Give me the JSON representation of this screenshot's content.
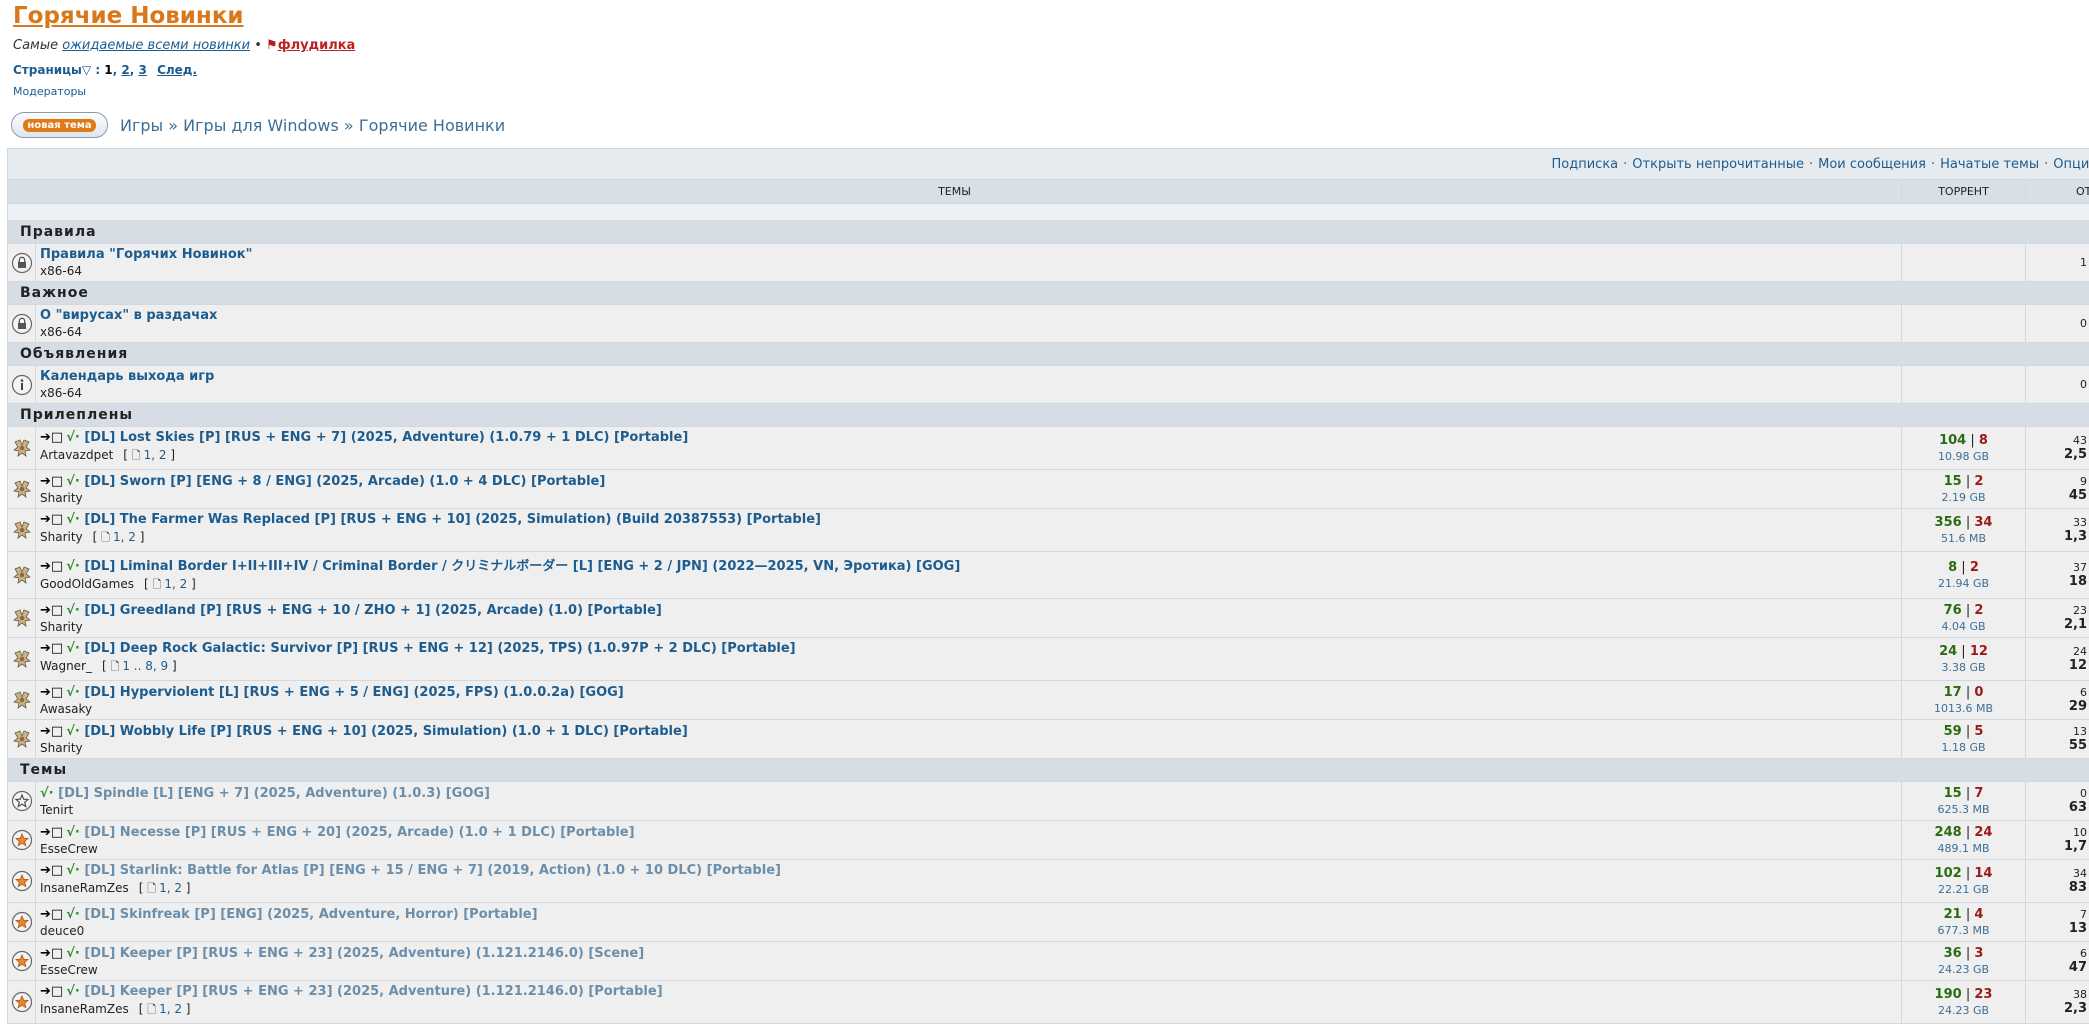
{
  "header": {
    "title": "Горячие Новинки",
    "subtitle_prefix": "Самые",
    "subtitle_link": "ожидаемые всеми новинки",
    "subtitle_sep": "•",
    "flood_link": "флудилка",
    "pager_label": "Страницы",
    "pager_current": "1",
    "pager_pages": [
      "2",
      "3"
    ],
    "pager_next": "След.",
    "moderators": "Модераторы"
  },
  "nav": {
    "new_topic_label": "новая тема",
    "breadcrumb": [
      "Игры",
      "Игры для Windows",
      "Горячие Новинки"
    ],
    "sep": "»"
  },
  "toolbar": [
    "Подписка",
    "Открыть непрочитанные",
    "Мои сообщения",
    "Начатые темы",
    "Опции показа"
  ],
  "columns": {
    "topics": "ТЕМЫ",
    "torrent": "ТОРРЕНТ",
    "replies": "ОТ"
  },
  "sections": {
    "rules": "Правила",
    "important": "Важное",
    "announcements": "Объявления",
    "sticky": "Прилеплены",
    "topics": "Темы"
  },
  "rules_topics": [
    {
      "title": "Правила \"Горячих Новинок\"",
      "author": "x86-64",
      "replies": "1",
      "icon": "lock-icon"
    }
  ],
  "important_topics": [
    {
      "title": "О \"вирусах\" в раздачах",
      "author": "x86-64",
      "replies": "0",
      "icon": "lock-icon"
    }
  ],
  "announcement_topics": [
    {
      "title": "Календарь выхода игр",
      "author": "x86-64",
      "replies": "0",
      "icon": "info-icon"
    }
  ],
  "sticky_topics": [
    {
      "title": "[DL] Lost Skies [P] [RUS + ENG + 7] (2025, Adventure) (1.0.79 + 1 DLC) [Portable]",
      "author": "Artavazdpet",
      "pages": "1, 2",
      "seeds": "104",
      "leech": "8",
      "size": "10.98 GB",
      "replies": "43",
      "views": "2,5"
    },
    {
      "title": "[DL] Sworn [P] [ENG + 8 / ENG] (2025, Arcade) (1.0 + 4 DLC) [Portable]",
      "author": "Sharity",
      "pages": "",
      "seeds": "15",
      "leech": "2",
      "size": "2.19 GB",
      "replies": "9",
      "views": "45"
    },
    {
      "title": "[DL] The Farmer Was Replaced [P] [RUS + ENG + 10] (2025, Simulation) (Build 20387553) [Portable]",
      "author": "Sharity",
      "pages": "1, 2",
      "seeds": "356",
      "leech": "34",
      "size": "51.6 MB",
      "replies": "33",
      "views": "1,3"
    },
    {
      "title": "[DL] Liminal Border I+II+III+IV / Criminal Border / クリミナルボーダー [L] [ENG + 2 / JPN] (2022—2025, VN, Эротика) [GOG]",
      "author": "GoodOldGames",
      "pages": "1, 2",
      "seeds": "8",
      "leech": "2",
      "size": "21.94 GB",
      "replies": "37",
      "views": "18"
    },
    {
      "title": "[DL] Greedland [P] [RUS + ENG + 10 / ZHO + 1] (2025, Arcade) (1.0) [Portable]",
      "author": "Sharity",
      "pages": "",
      "seeds": "76",
      "leech": "2",
      "size": "4.04 GB",
      "replies": "23",
      "views": "2,1"
    },
    {
      "title": "[DL] Deep Rock Galactic: Survivor [P] [RUS + ENG + 12] (2025, TPS) (1.0.97P + 2 DLC) [Portable]",
      "author": "Wagner_",
      "pages": "1 .. 8, 9",
      "seeds": "24",
      "leech": "12",
      "size": "3.38 GB",
      "replies": "24",
      "views": "12"
    },
    {
      "title": "[DL] Hyperviolent [L] [RUS + ENG + 5 / ENG] (2025, FPS) (1.0.0.2a) [GOG]",
      "author": "Awasaky",
      "pages": "",
      "seeds": "17",
      "leech": "0",
      "size": "1013.6 MB",
      "replies": "6",
      "views": "29"
    },
    {
      "title": "[DL] Wobbly Life [P] [RUS + ENG + 10] (2025, Simulation) (1.0 + 1 DLC) [Portable]",
      "author": "Sharity",
      "pages": "",
      "seeds": "59",
      "leech": "5",
      "size": "1.18 GB",
      "replies": "13",
      "views": "55"
    }
  ],
  "normal_topics": [
    {
      "title": "[DL] Spindle [L] [ENG + 7] (2025, Adventure) (1.0.3) [GOG]",
      "author": "Tenirt",
      "pages": "",
      "seeds": "15",
      "leech": "7",
      "size": "625.3 MB",
      "replies": "0",
      "views": "63",
      "arrows": false,
      "icon": "star-outline-icon"
    },
    {
      "title": "[DL] Necesse [P] [RUS + ENG + 20] (2025, Arcade) (1.0 + 1 DLC) [Portable]",
      "author": "EsseCrew",
      "pages": "",
      "seeds": "248",
      "leech": "24",
      "size": "489.1 MB",
      "replies": "10",
      "views": "1,7",
      "arrows": true,
      "icon": "star-icon"
    },
    {
      "title": "[DL] Starlink: Battle for Atlas [P] [ENG + 15 / ENG + 7] (2019, Action) (1.0 + 10 DLC) [Portable]",
      "author": "InsaneRamZes",
      "pages": "1, 2",
      "seeds": "102",
      "leech": "14",
      "size": "22.21 GB",
      "replies": "34",
      "views": "83",
      "arrows": true,
      "icon": "star-icon"
    },
    {
      "title": "[DL] Skinfreak [P] [ENG] (2025, Adventure, Horror) [Portable]",
      "author": "deuce0",
      "pages": "",
      "seeds": "21",
      "leech": "4",
      "size": "677.3 MB",
      "replies": "7",
      "views": "13",
      "arrows": true,
      "icon": "star-icon"
    },
    {
      "title": "[DL] Keeper [P] [RUS + ENG + 23] (2025, Adventure) (1.121.2146.0) [Scene]",
      "author": "EsseCrew",
      "pages": "",
      "seeds": "36",
      "leech": "3",
      "size": "24.23 GB",
      "replies": "6",
      "views": "47",
      "arrows": true,
      "icon": "star-icon"
    },
    {
      "title": "[DL] Keeper [P] [RUS + ENG + 23] (2025, Adventure) (1.121.2146.0) [Portable]",
      "author": "InsaneRamZes",
      "pages": "1, 2",
      "seeds": "190",
      "leech": "23",
      "size": "24.23 GB",
      "replies": "38",
      "views": "2,3",
      "arrows": true,
      "icon": "star-icon"
    }
  ],
  "colors": {
    "title_orange": "#d9771b",
    "link_blue": "#1d5c8e",
    "seed_green": "#2b6b12",
    "leech_red": "#9b1b1b",
    "check_green": "#2a8a2a"
  }
}
